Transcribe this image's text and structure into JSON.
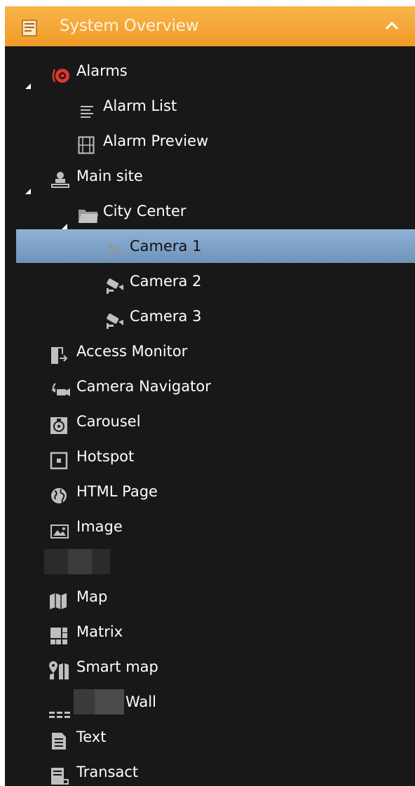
{
  "header": {
    "title": "System Overview",
    "icon": "list-panel-icon",
    "collapse_icon": "chevron-up-icon"
  },
  "colors": {
    "header_accent": "#f5a733",
    "selection": "#7fa3c9",
    "panel_bg": "#181818",
    "alarm_red": "#e0362b"
  },
  "tree": {
    "alarms": {
      "label": "Alarms",
      "icon": "alarm-icon",
      "expanded": true,
      "children": [
        {
          "label": "Alarm List",
          "icon": "list-icon"
        },
        {
          "label": "Alarm Preview",
          "icon": "film-icon"
        }
      ]
    },
    "main_site": {
      "label": "Main site",
      "icon": "site-server-icon",
      "expanded": true,
      "city_center": {
        "label": "City Center",
        "icon": "folder-icon",
        "expanded": true,
        "cameras": [
          {
            "label": "Camera 1",
            "selected": true
          },
          {
            "label": "Camera 2"
          },
          {
            "label": "Camera 3"
          }
        ]
      }
    }
  },
  "items": [
    {
      "label": "Access Monitor",
      "icon": "door-icon"
    },
    {
      "label": "Camera Navigator",
      "icon": "camera-navigator-icon"
    },
    {
      "label": "Carousel",
      "icon": "carousel-icon"
    },
    {
      "label": "Hotspot",
      "icon": "hotspot-icon"
    },
    {
      "label": "HTML Page",
      "icon": "globe-icon"
    },
    {
      "label": "Image",
      "icon": "image-icon"
    },
    {
      "label": "Map",
      "icon": "map-icon"
    },
    {
      "label": "Matrix",
      "icon": "matrix-icon"
    },
    {
      "label": "Smart map",
      "icon": "smart-map-icon"
    },
    {
      "label": "Wall",
      "icon": "video-wall-icon"
    },
    {
      "label": "Text",
      "icon": "text-icon"
    },
    {
      "label": "Transact",
      "icon": "transact-icon"
    }
  ]
}
